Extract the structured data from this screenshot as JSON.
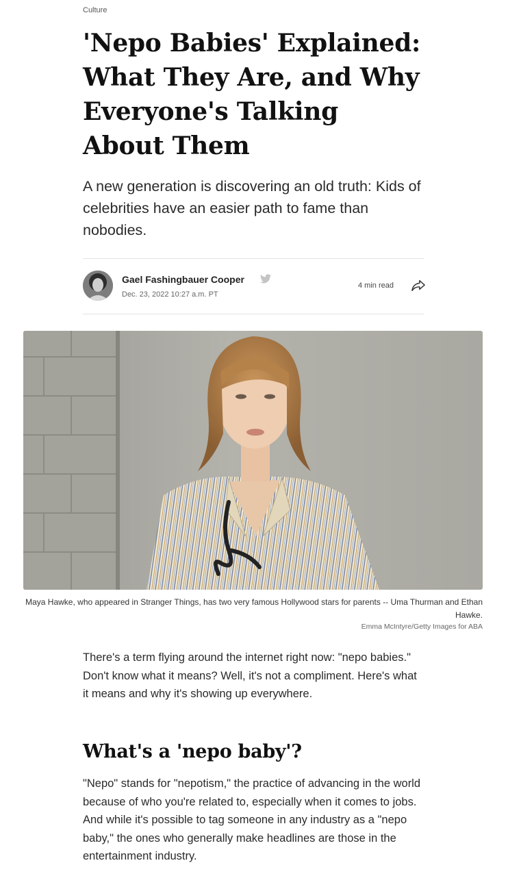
{
  "article": {
    "category": "Culture",
    "title": "'Nepo Babies' Explained: What They Are, and Why Everyone's Talking About Them",
    "dek": "A new generation is discovering an old truth: Kids of celebrities have an easier path to fame than nobodies.",
    "byline": {
      "author": "Gael Fashingbauer Cooper",
      "date": "Dec. 23, 2022 10:27 a.m. PT",
      "read_time": "4 min read"
    },
    "image": {
      "caption": "Maya Hawke, who appeared in Stranger Things, has two very famous Hollywood stars for parents -- Uma Thurman and Ethan Hawke.",
      "credit": "Emma McIntyre/Getty Images for ABA"
    },
    "paragraph_1": "There's a term flying around the internet right now: \"nepo babies.\" Don't know what it means? Well, it's not a compliment. Here's what it means and why it's showing up everywhere.",
    "subheading": "What's a 'nepo baby'?",
    "paragraph_2": "\"Nepo\" stands for \"nepotism,\" the practice of advancing in the world because of who you're related to, especially when it comes to jobs. And while it's possible to tag someone in any industry as a \"nepo baby,\" the ones who generally make headlines are those in the entertainment industry."
  },
  "colors": {
    "text": "#1f1f1f",
    "muted": "#666666",
    "divider": "#e3e3e3",
    "twitter_icon": "#c4c4c4"
  },
  "icons": {
    "author_social": "twitter-bird-icon",
    "share": "share-arrow-icon"
  }
}
